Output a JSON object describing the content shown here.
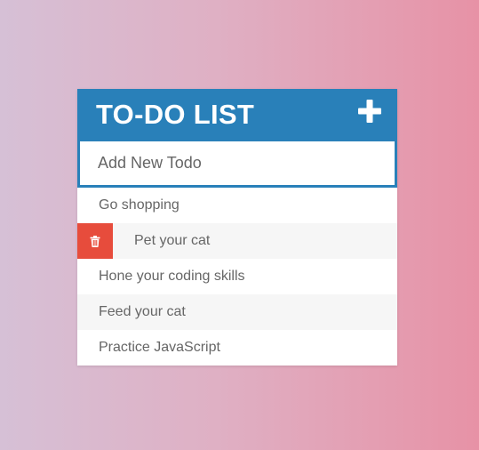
{
  "header": {
    "title": "TO-DO LIST",
    "add_icon": "plus-icon",
    "background": "#2980b9"
  },
  "input": {
    "placeholder": "Add New Todo",
    "value": ""
  },
  "todos": [
    {
      "text": "Go shopping"
    },
    {
      "text": "Pet your cat",
      "hover": true,
      "delete_icon": "trash-icon"
    },
    {
      "text": "Hone your coding skills"
    },
    {
      "text": "Feed your cat"
    },
    {
      "text": "Practice JavaScript"
    }
  ],
  "colors": {
    "accent": "#2980b9",
    "delete": "#e74c3c",
    "text": "#666666",
    "alt_row": "#f6f6f6"
  }
}
